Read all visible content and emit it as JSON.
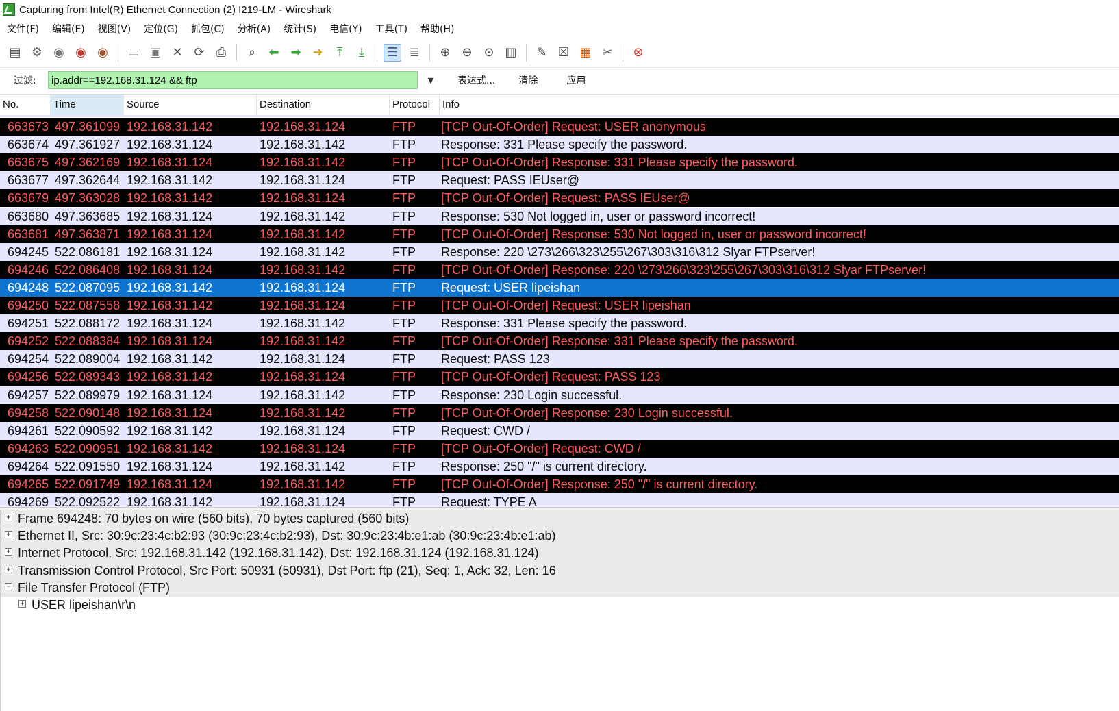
{
  "window": {
    "title": "Capturing from Intel(R) Ethernet Connection (2) I219-LM - Wireshark",
    "icon": "wireshark-fin-icon"
  },
  "menu": [
    "文件(F)",
    "编辑(E)",
    "视图(V)",
    "定位(G)",
    "抓包(C)",
    "分析(A)",
    "统计(S)",
    "电信(Y)",
    "工具(T)",
    "帮助(H)"
  ],
  "filter": {
    "label": "过滤:",
    "value": "ip.addr==192.168.31.124 && ftp",
    "expression": "表达式...",
    "clear": "清除",
    "apply": "应用",
    "bg_color": "#b1f3b1"
  },
  "columns": [
    "No.",
    "Time",
    "Source",
    "Destination",
    "Protocol",
    "Info"
  ],
  "colors": {
    "error_bg": "#000000",
    "error_fg": "#ff5b5b",
    "normal_bg": "#e7e6ff",
    "selected_bg": "#0f73d0"
  },
  "packets": [
    {
      "no": "663673",
      "time": "497.361099",
      "src": "192.168.31.142",
      "dst": "192.168.31.124",
      "proto": "FTP",
      "info": "[TCP Out-Of-Order] Request: USER anonymous",
      "style": "err"
    },
    {
      "no": "663674",
      "time": "497.361927",
      "src": "192.168.31.124",
      "dst": "192.168.31.142",
      "proto": "FTP",
      "info": "Response: 331 Please specify the password.",
      "style": "norm"
    },
    {
      "no": "663675",
      "time": "497.362169",
      "src": "192.168.31.124",
      "dst": "192.168.31.142",
      "proto": "FTP",
      "info": "[TCP Out-Of-Order] Response: 331 Please specify the password.",
      "style": "err"
    },
    {
      "no": "663677",
      "time": "497.362644",
      "src": "192.168.31.142",
      "dst": "192.168.31.124",
      "proto": "FTP",
      "info": "Request: PASS IEUser@",
      "style": "norm"
    },
    {
      "no": "663679",
      "time": "497.363028",
      "src": "192.168.31.142",
      "dst": "192.168.31.124",
      "proto": "FTP",
      "info": "[TCP Out-Of-Order] Request: PASS IEUser@",
      "style": "err"
    },
    {
      "no": "663680",
      "time": "497.363685",
      "src": "192.168.31.124",
      "dst": "192.168.31.142",
      "proto": "FTP",
      "info": "Response: 530 Not logged in, user or password incorrect!",
      "style": "norm"
    },
    {
      "no": "663681",
      "time": "497.363871",
      "src": "192.168.31.124",
      "dst": "192.168.31.142",
      "proto": "FTP",
      "info": "[TCP Out-Of-Order] Response: 530 Not logged in, user or password incorrect!",
      "style": "err"
    },
    {
      "no": "694245",
      "time": "522.086181",
      "src": "192.168.31.124",
      "dst": "192.168.31.142",
      "proto": "FTP",
      "info": "Response: 220 \\273\\266\\323\\255\\267\\303\\316\\312 Slyar FTPserver!",
      "style": "norm"
    },
    {
      "no": "694246",
      "time": "522.086408",
      "src": "192.168.31.124",
      "dst": "192.168.31.142",
      "proto": "FTP",
      "info": "[TCP Out-Of-Order] Response: 220 \\273\\266\\323\\255\\267\\303\\316\\312 Slyar FTPserver!",
      "style": "err"
    },
    {
      "no": "694248",
      "time": "522.087095",
      "src": "192.168.31.142",
      "dst": "192.168.31.124",
      "proto": "FTP",
      "info": "Request: USER lipeishan",
      "style": "sel"
    },
    {
      "no": "694250",
      "time": "522.087558",
      "src": "192.168.31.142",
      "dst": "192.168.31.124",
      "proto": "FTP",
      "info": "[TCP Out-Of-Order] Request: USER lipeishan",
      "style": "err"
    },
    {
      "no": "694251",
      "time": "522.088172",
      "src": "192.168.31.124",
      "dst": "192.168.31.142",
      "proto": "FTP",
      "info": "Response: 331 Please specify the password.",
      "style": "norm"
    },
    {
      "no": "694252",
      "time": "522.088384",
      "src": "192.168.31.124",
      "dst": "192.168.31.142",
      "proto": "FTP",
      "info": "[TCP Out-Of-Order] Response: 331 Please specify the password.",
      "style": "err"
    },
    {
      "no": "694254",
      "time": "522.089004",
      "src": "192.168.31.142",
      "dst": "192.168.31.124",
      "proto": "FTP",
      "info": "Request: PASS 123",
      "style": "norm"
    },
    {
      "no": "694256",
      "time": "522.089343",
      "src": "192.168.31.142",
      "dst": "192.168.31.124",
      "proto": "FTP",
      "info": "[TCP Out-Of-Order] Request: PASS 123",
      "style": "err"
    },
    {
      "no": "694257",
      "time": "522.089979",
      "src": "192.168.31.124",
      "dst": "192.168.31.142",
      "proto": "FTP",
      "info": "Response: 230 Login successful.",
      "style": "norm"
    },
    {
      "no": "694258",
      "time": "522.090148",
      "src": "192.168.31.124",
      "dst": "192.168.31.142",
      "proto": "FTP",
      "info": "[TCP Out-Of-Order] Response: 230 Login successful.",
      "style": "err"
    },
    {
      "no": "694261",
      "time": "522.090592",
      "src": "192.168.31.142",
      "dst": "192.168.31.124",
      "proto": "FTP",
      "info": "Request: CWD /",
      "style": "norm"
    },
    {
      "no": "694263",
      "time": "522.090951",
      "src": "192.168.31.142",
      "dst": "192.168.31.124",
      "proto": "FTP",
      "info": "[TCP Out-Of-Order] Request: CWD /",
      "style": "err"
    },
    {
      "no": "694264",
      "time": "522.091550",
      "src": "192.168.31.124",
      "dst": "192.168.31.142",
      "proto": "FTP",
      "info": "Response: 250 \"/\" is current directory.",
      "style": "norm"
    },
    {
      "no": "694265",
      "time": "522.091749",
      "src": "192.168.31.124",
      "dst": "192.168.31.142",
      "proto": "FTP",
      "info": "[TCP Out-Of-Order] Response: 250 \"/\" is current directory.",
      "style": "err"
    },
    {
      "no": "694269",
      "time": "522.092522",
      "src": "192.168.31.142",
      "dst": "192.168.31.124",
      "proto": "FTP",
      "info": "Request: TYPE A",
      "style": "norm"
    }
  ],
  "details": [
    {
      "text": "Frame 694248: 70 bytes on wire (560 bits), 70 bytes captured (560 bits)",
      "expanded": false,
      "indent": 0
    },
    {
      "text": "Ethernet II, Src: 30:9c:23:4c:b2:93 (30:9c:23:4c:b2:93), Dst: 30:9c:23:4b:e1:ab (30:9c:23:4b:e1:ab)",
      "expanded": false,
      "indent": 0
    },
    {
      "text": "Internet Protocol, Src: 192.168.31.142 (192.168.31.142), Dst: 192.168.31.124 (192.168.31.124)",
      "expanded": false,
      "indent": 0
    },
    {
      "text": "Transmission Control Protocol, Src Port: 50931 (50931), Dst Port: ftp (21), Seq: 1, Ack: 32, Len: 16",
      "expanded": false,
      "indent": 0
    },
    {
      "text": "File Transfer Protocol (FTP)",
      "expanded": true,
      "indent": 0
    },
    {
      "text": "USER lipeishan\\r\\n",
      "expanded": false,
      "indent": 1
    }
  ]
}
